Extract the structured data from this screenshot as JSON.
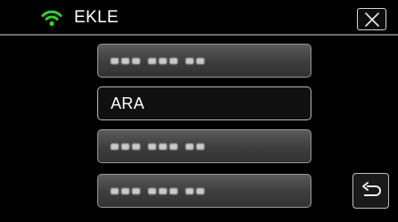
{
  "header": {
    "title": "EKLE",
    "wifi_icon": "wifi-icon",
    "close_icon": "close-icon",
    "accent_color": "#2fd32f"
  },
  "list": {
    "items": [
      {
        "label": "",
        "masked": true,
        "selected": false
      },
      {
        "label": "ARA",
        "masked": false,
        "selected": true
      },
      {
        "label": "",
        "masked": true,
        "selected": false
      },
      {
        "label": "",
        "masked": true,
        "selected": false
      }
    ]
  },
  "footer": {
    "back_icon": "return-arrow-icon"
  }
}
